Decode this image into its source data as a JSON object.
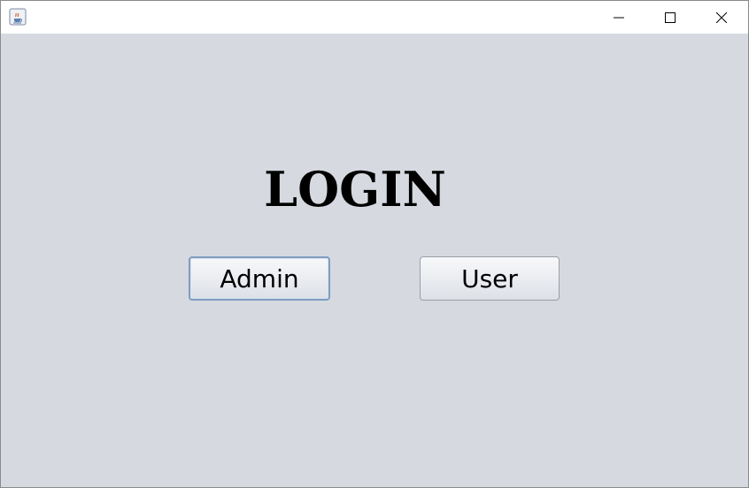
{
  "window": {
    "title": "",
    "controls": {
      "minimize_icon": "minimize-icon",
      "maximize_icon": "maximize-icon",
      "close_icon": "close-icon"
    },
    "app_icon": "java-coffee-cup-icon"
  },
  "main": {
    "heading": "LOGIN",
    "buttons": {
      "admin_label": "Admin",
      "user_label": "User"
    }
  },
  "colors": {
    "background": "#d6d9e0",
    "titlebar": "#ffffff",
    "focus_border": "#7f9cc0"
  }
}
